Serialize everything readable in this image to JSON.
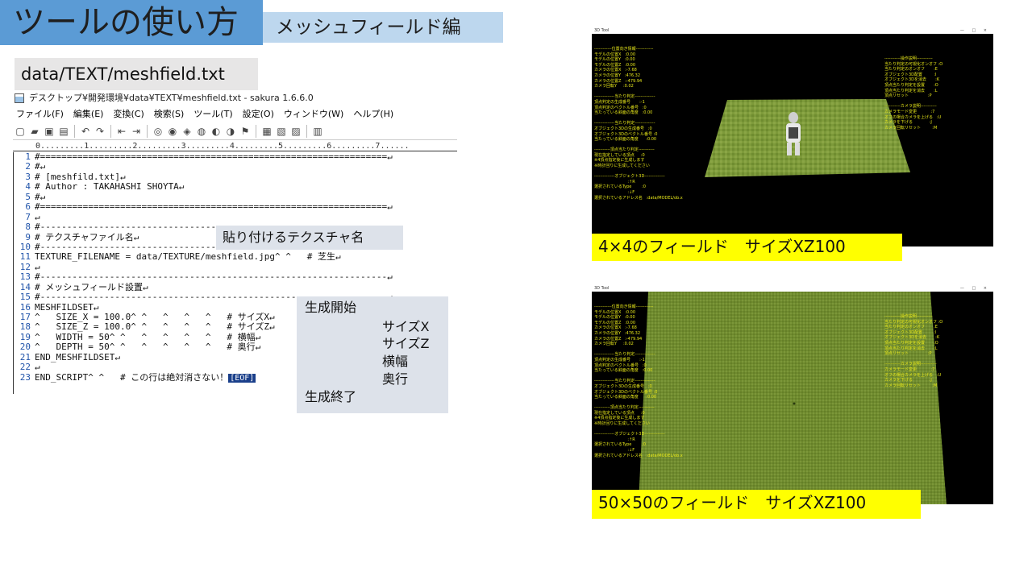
{
  "slide": {
    "title": "ツールの使い方",
    "subtitle": "メッシュフィールド編",
    "path_label": "data/TEXT/meshfield.txt"
  },
  "editor": {
    "window_title": "デスクトップ¥開発環境¥data¥TEXT¥meshfield.txt - sakura 1.6.6.0",
    "menu": [
      "ファイル(F)",
      "編集(E)",
      "変換(C)",
      "検索(S)",
      "ツール(T)",
      "設定(O)",
      "ウィンドウ(W)",
      "ヘルプ(H)"
    ],
    "toolbar_icons": [
      "new-file-icon",
      "open-folder-icon",
      "save-icon",
      "save-all-icon",
      "undo-icon",
      "redo-icon",
      "back-icon",
      "forward-icon",
      "search-icon",
      "search-next-icon",
      "grep-icon",
      "replace-icon",
      "bookmark-icon",
      "jump-icon",
      "compare-icon",
      "outline-icon",
      "format-icon",
      "settings-icon"
    ],
    "ruler": "0.........1.........2.........3.........4.........5.........6.........7......",
    "line_numbers": [
      "1",
      "2",
      "3",
      "4",
      "5",
      "6",
      "7",
      "8",
      "9",
      "10",
      "11",
      "12",
      "13",
      "14",
      "15",
      "16",
      "17",
      "18",
      "19",
      "20",
      "21",
      "22",
      "23"
    ],
    "lines": [
      "#=================================================================↵",
      "#↵",
      "# [meshfild.txt]↵",
      "# Author : TAKAHASHI SHOYTA↵",
      "#↵",
      "#=================================================================↵",
      "↵",
      "#-----------------------------------------------------------------↵",
      "# テクスチャファイル名↵",
      "#-----------------------------------------------------------------↵",
      "TEXTURE_FILENAME = data/TEXTURE/meshfield.jpg^ ^   # 芝生↵",
      "↵",
      "#-----------------------------------------------------------------↵",
      "# メッシュフィールド設置↵",
      "#-----------------------------------------------------------------↵",
      "MESHFILDSET↵",
      "^   SIZE_X = 100.0^ ^   ^   ^   ^   # サイズX↵",
      "^   SIZE_Z = 100.0^ ^   ^   ^   ^   # サイズZ↵",
      "^   WIDTH = 50^ ^   ^   ^   ^   ^   # 横幅↵",
      "^   DEPTH = 50^ ^   ^   ^   ^   ^   # 奥行↵",
      "END_MESHFILDSET↵",
      "↵",
      "END_SCRIPT^ ^   # この行は絶対消さない！"
    ],
    "eof_marker": "[EOF]"
  },
  "notes": {
    "texture": "貼り付けるテクスチャ名",
    "gen_start": "生成開始",
    "size_x": "サイズX",
    "size_z": "サイズZ",
    "width": "横幅",
    "depth": "奥行",
    "gen_end": "生成終了"
  },
  "game": {
    "window_title": "3D Tool",
    "window_controls": "— □ ×",
    "hud_left": "------------位置向き情報------------\nモデルの位置X   :0.00\nモデルの位置Y   :0.00\nモデルの位置Z   :0.00\nカメラの位置X   :-7.68\nカメラの位置Y   :476.32\nカメラの位置Z   :-479.94\nカメラ回転Y     :0.02\n\n--------------当たり判定--------------\n頂点判定の生成番号       :-1\n頂点判定のベクトル番号   :0\n当たっている斜面の角度   :0.00\n\n--------------当たり判定--------------\nオブジェクト3Dの生成番号   :0\nオブジェクト3Dのベクトル番号 :0\n当たっている斜面の角度      :0.00\n\n-----------頂点当たり判定-----------\n現在指定している頂点     :0\n※4頂点指定後に生成します\n※時計回りに生成してください\n\n--------------オブジェクト3D--------------\n                          :↑R\n選択されているType        :0\n                          :↓F\n選択されているアドレス名   :data/MODEL/ob.x",
    "hud_right": "-----------操作説明-----------\n当たり判定の可視化オンオフ :O\n当たり判定のオンオフ       :E\nオブジェクト3D配置         :I\nオブジェクト3Dを消去       :K\n頂点当たり判定を設置       :O\n頂点当たり判定を消去       :L\n頂点リセット               :P\n\n-----------カメラ説明-----------\nカメラモード変更           :7\nオフの場合カメラを上げる   :U\nカメラを下げる             :J\nカメラ回転リセット         :M",
    "caption_1": "4×4のフィールド　サイズXZ100",
    "caption_2": "50×50のフィールド　サイズXZ100"
  }
}
